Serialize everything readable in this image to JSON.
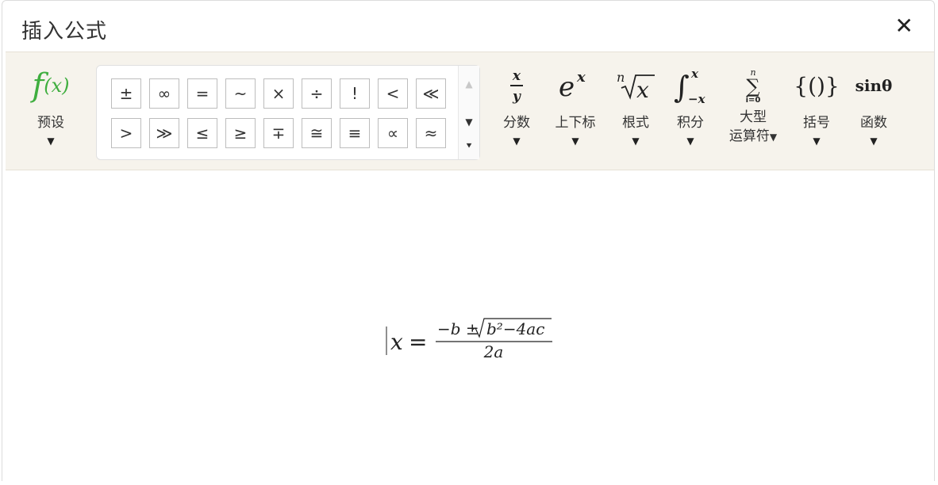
{
  "dialog": {
    "title": "插入公式",
    "close_glyph": "✕"
  },
  "toolbar": {
    "preset": {
      "glyph": "f(x)",
      "label": "预设"
    },
    "symbols_row1": [
      "±",
      "∞",
      "=",
      "~",
      "×",
      "÷",
      "!",
      "<",
      "≪"
    ],
    "symbols_row2": [
      ">",
      "≫",
      "≤",
      "≥",
      "∓",
      "≅",
      "≡",
      "∝",
      "≈"
    ],
    "scroll": {
      "up": "▲",
      "down": "▼",
      "more": "⯆"
    },
    "tools": [
      {
        "id": "fraction",
        "label": "分数"
      },
      {
        "id": "script",
        "label": "上下标"
      },
      {
        "id": "radical",
        "label": "根式"
      },
      {
        "id": "integral",
        "label": "积分"
      },
      {
        "id": "large-operator",
        "label": "大型\n运算符"
      },
      {
        "id": "bracket",
        "label": "括号"
      },
      {
        "id": "function",
        "label": "函数"
      }
    ],
    "caret": "▼"
  },
  "editor": {
    "formula_text": "x = (−b ± √(b² − 4ac)) / 2a",
    "lhs": "x",
    "numerator_minus_b": "−b ±",
    "radicand": "b² − 4ac",
    "denominator": "2a"
  }
}
